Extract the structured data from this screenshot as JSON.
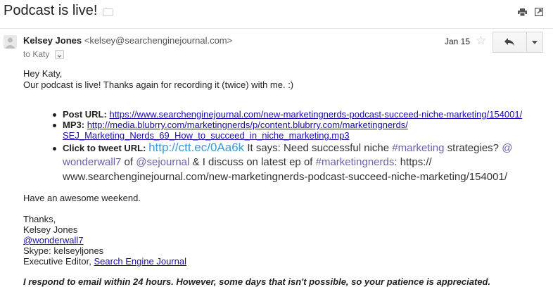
{
  "subject": "Podcast is live!",
  "header": {
    "sender_name": "Kelsey Jones",
    "sender_email": "<kelsey@searchenginejournal.com>",
    "to_label": "to Katy",
    "date": "Jan 15"
  },
  "message": {
    "greeting": "Hey Katy,",
    "intro": "Our podcast is live! Thanks again for recording it (twice) with me. :)",
    "post_label": "Post URL:",
    "post_url": "https://www.searchenginejournal.com/new-marketingnerds-podcast-succeed-niche-marketing/154001/",
    "mp3_label": "MP3:",
    "mp3_url_line1": "http://media.blubrry.com/marketingnerds/p/content.blubrry.com/marketingnerds/",
    "mp3_url_line2": "SEJ_Marketing_Nerds_69_How_to_succeed_in_niche_marketing.mp3",
    "tweet_label": "Click to tweet URL:",
    "tweet_url": "http://ctt.ec/0Aa6k",
    "tweet_text1": " It says: Need successful niche ",
    "tweet_hashtag1": "#marketing",
    "tweet_text2": " strategies? ",
    "tweet_mention1_a": "@",
    "tweet_mention1_b": "wonderwall7",
    "tweet_text3": " of ",
    "tweet_mention2": "@sejournal",
    "tweet_text4": " & I discuss on latest ep of ",
    "tweet_hashtag2": "#marketingnerds",
    "tweet_text5": ": https://",
    "tweet_line3": "www.searchenginejournal.com/new-marketingnerds-podcast-succeed-niche-marketing/154001/",
    "closing": "Have an awesome weekend.",
    "thanks": "Thanks,",
    "sig_name": "Kelsey Jones",
    "sig_handle": "@wonderwall7",
    "sig_skype": "Skype: kelseyljones",
    "sig_title_prefix": "Executive Editor, ",
    "sig_company": "Search Engine Journal",
    "footer": "I respond to email within 24 hours. However, some days that isn't possible, so your patience is appreciated."
  }
}
